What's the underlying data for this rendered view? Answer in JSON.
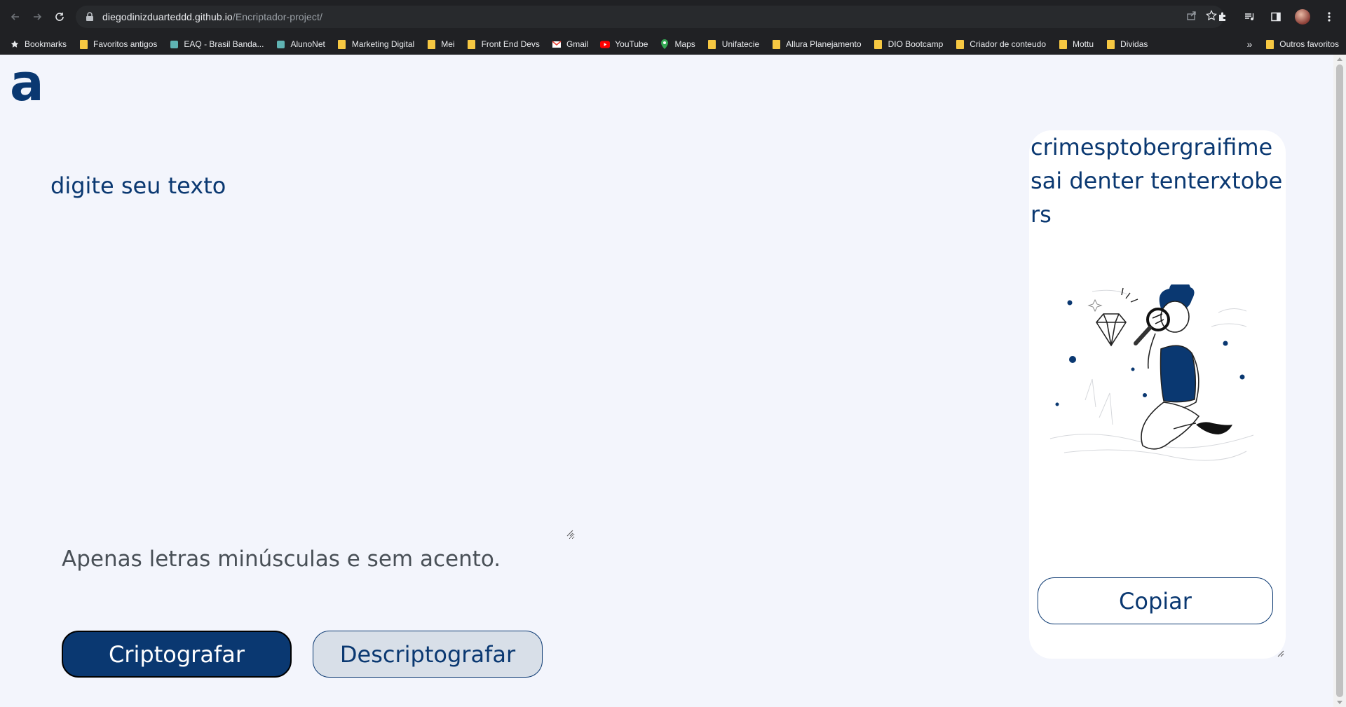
{
  "browser": {
    "url_host": "diegodinizduarteddd.github.io",
    "url_path": "/Encriptador-project/",
    "bookmarks": [
      {
        "label": "Bookmarks",
        "icon": "star-icon"
      },
      {
        "label": "Favoritos antigos",
        "icon": "folder-icon"
      },
      {
        "label": "EAQ - Brasil Banda...",
        "icon": "site-icon"
      },
      {
        "label": "AlunoNet",
        "icon": "site-icon"
      },
      {
        "label": "Marketing Digital",
        "icon": "folder-icon"
      },
      {
        "label": "Mei",
        "icon": "folder-icon"
      },
      {
        "label": "Front End Devs",
        "icon": "folder-icon"
      },
      {
        "label": "Gmail",
        "icon": "gmail-icon"
      },
      {
        "label": "YouTube",
        "icon": "youtube-icon"
      },
      {
        "label": "Maps",
        "icon": "maps-icon"
      },
      {
        "label": "Unifatecie",
        "icon": "folder-icon"
      },
      {
        "label": "Allura Planejamento",
        "icon": "folder-icon"
      },
      {
        "label": "DIO Bootcamp",
        "icon": "folder-icon"
      },
      {
        "label": "Criador de conteudo",
        "icon": "folder-icon"
      },
      {
        "label": "Mottu",
        "icon": "folder-icon"
      },
      {
        "label": "Dividas",
        "icon": "folder-icon"
      }
    ],
    "bookmarks_overflow": "»",
    "other_bookmarks": "Outros favoritos"
  },
  "page": {
    "logo": "a",
    "input_placeholder": "digite seu texto",
    "hint": "Apenas letras minúsculas e sem acento.",
    "encrypt_label": "Criptografar",
    "decrypt_label": "Descriptografar",
    "output_text": "crimesptobergraifimesai denter tenterxtobers",
    "copy_label": "Copiar"
  },
  "colors": {
    "primary": "#0a3871",
    "background": "#f3f5fc",
    "secondary_button": "#d8dfe8"
  }
}
